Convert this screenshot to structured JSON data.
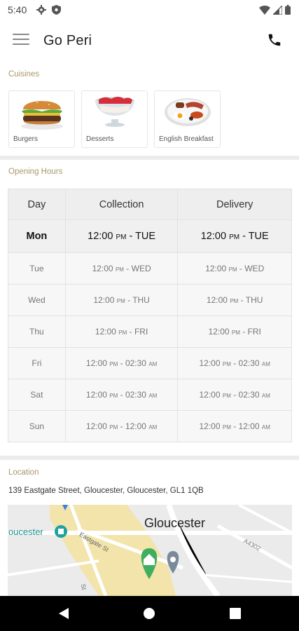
{
  "status_bar": {
    "time": "5:40",
    "left_icons": [
      "gear-icon",
      "shield-icon"
    ],
    "right_icons": [
      "wifi-icon",
      "signal-icon",
      "battery-icon"
    ]
  },
  "app_bar": {
    "title": "Go Peri",
    "menu_icon": "hamburger-menu-icon",
    "action_icon": "phone-icon"
  },
  "cuisines": {
    "label": "Cuisines",
    "items": [
      {
        "label": "Burgers",
        "icon": "burger-image"
      },
      {
        "label": "Desserts",
        "icon": "dessert-image"
      },
      {
        "label": "English Breakfast",
        "icon": "english-breakfast-image"
      }
    ]
  },
  "opening_hours": {
    "label": "Opening Hours",
    "headers": {
      "day": "Day",
      "collection": "Collection",
      "delivery": "Delivery"
    },
    "rows": [
      {
        "day": "Mon",
        "coll_start": "12:00",
        "coll_start_ampm": "PM",
        "coll_end": "TUE",
        "coll_end_ampm": "",
        "del_start": "12:00",
        "del_start_ampm": "PM",
        "del_end": "TUE",
        "del_end_ampm": ""
      },
      {
        "day": "Tue",
        "coll_start": "12:00",
        "coll_start_ampm": "PM",
        "coll_end": "WED",
        "coll_end_ampm": "",
        "del_start": "12:00",
        "del_start_ampm": "PM",
        "del_end": "WED",
        "del_end_ampm": ""
      },
      {
        "day": "Wed",
        "coll_start": "12:00",
        "coll_start_ampm": "PM",
        "coll_end": "THU",
        "coll_end_ampm": "",
        "del_start": "12:00",
        "del_start_ampm": "PM",
        "del_end": "THU",
        "del_end_ampm": ""
      },
      {
        "day": "Thu",
        "coll_start": "12:00",
        "coll_start_ampm": "PM",
        "coll_end": "FRI",
        "coll_end_ampm": "",
        "del_start": "12:00",
        "del_start_ampm": "PM",
        "del_end": "FRI",
        "del_end_ampm": ""
      },
      {
        "day": "Fri",
        "coll_start": "12:00",
        "coll_start_ampm": "PM",
        "coll_end": "02:30",
        "coll_end_ampm": "AM",
        "del_start": "12:00",
        "del_start_ampm": "PM",
        "del_end": "02:30",
        "del_end_ampm": "AM"
      },
      {
        "day": "Sat",
        "coll_start": "12:00",
        "coll_start_ampm": "PM",
        "coll_end": "02:30",
        "coll_end_ampm": "AM",
        "del_start": "12:00",
        "del_start_ampm": "PM",
        "del_end": "02:30",
        "del_end_ampm": "AM"
      },
      {
        "day": "Sun",
        "coll_start": "12:00",
        "coll_start_ampm": "PM",
        "coll_end": "12:00",
        "coll_end_ampm": "AM",
        "del_start": "12:00",
        "del_start_ampm": "PM",
        "del_end": "12:00",
        "del_end_ampm": "AM"
      }
    ]
  },
  "location": {
    "label": "Location",
    "address": "139 Eastgate Street, Gloucester, Gloucester, GL1 1QB",
    "map": {
      "city_label": "Gloucester",
      "area_label": "loucester",
      "street_label": "Eastgate St",
      "road_label": "A4302",
      "side_street_label": "St"
    }
  },
  "nav_bar": {
    "icons": [
      "back-icon",
      "home-icon",
      "recents-icon"
    ]
  },
  "colors": {
    "section_label": "#a89868",
    "map_road": "#ffffff",
    "map_highlight": "#f5e6a8",
    "pin_green": "#3fae5e",
    "pin_grey": "#7a8a99"
  }
}
